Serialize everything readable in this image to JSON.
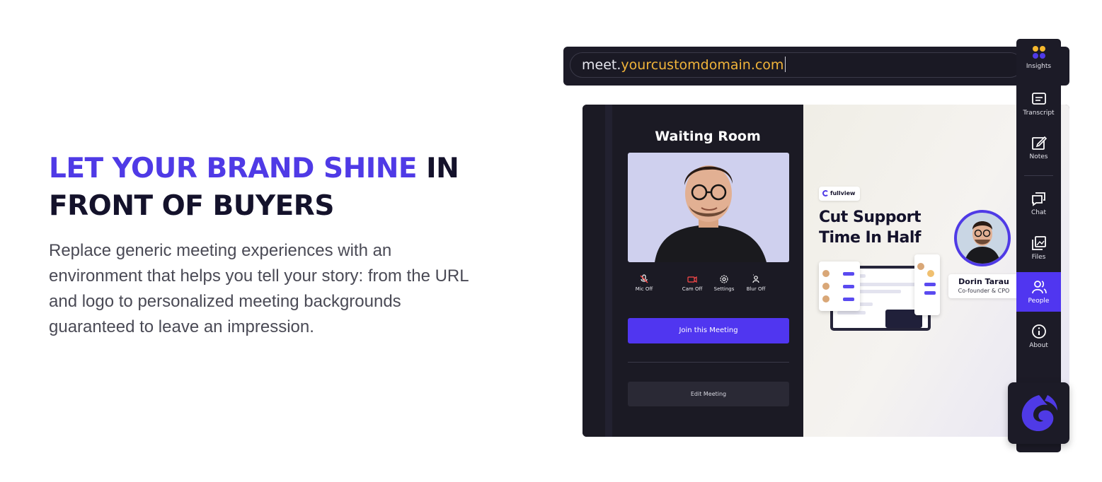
{
  "hero": {
    "headline_accent": "LET YOUR BRAND SHINE",
    "headline_rest_line1": " IN",
    "headline_line2": "FRONT OF BUYERS",
    "body": "Replace generic meeting experiences with an environment that helps you tell your story: from the URL and logo to personalized meeting backgrounds guaranteed to leave an impression."
  },
  "url_bar": {
    "prefix": "meet.",
    "domain": "yourcustomdomain.com"
  },
  "waiting_room": {
    "title": "Waiting Room",
    "controls": [
      {
        "label": "Mic Off",
        "icon": "mic-off-icon"
      },
      {
        "label": "Cam Off",
        "icon": "cam-off-icon"
      },
      {
        "label": "Settings",
        "icon": "gear-icon"
      },
      {
        "label": "Blur Off",
        "icon": "blur-icon"
      }
    ],
    "join_label": "Join this Meeting",
    "edit_label": "Edit Meeting"
  },
  "promo": {
    "badge": "fullview",
    "title_line1": "Cut Support",
    "title_line2": "Time In Half",
    "speaker_name": "Dorin Tarau",
    "speaker_role": "Co-founder & CPO"
  },
  "side_panel": {
    "items": [
      {
        "label": "Insights",
        "icon": "insights-icon"
      },
      {
        "label": "Transcript",
        "icon": "transcript-icon"
      },
      {
        "label": "Notes",
        "icon": "notes-icon"
      },
      {
        "label": "Chat",
        "icon": "chat-icon"
      },
      {
        "label": "Files",
        "icon": "files-icon"
      },
      {
        "label": "People",
        "icon": "people-icon",
        "active": true
      },
      {
        "label": "About",
        "icon": "info-icon"
      }
    ]
  },
  "colors": {
    "accent": "#4f3ae6",
    "domain": "#f1b43a",
    "dark": "#1c1b27"
  }
}
